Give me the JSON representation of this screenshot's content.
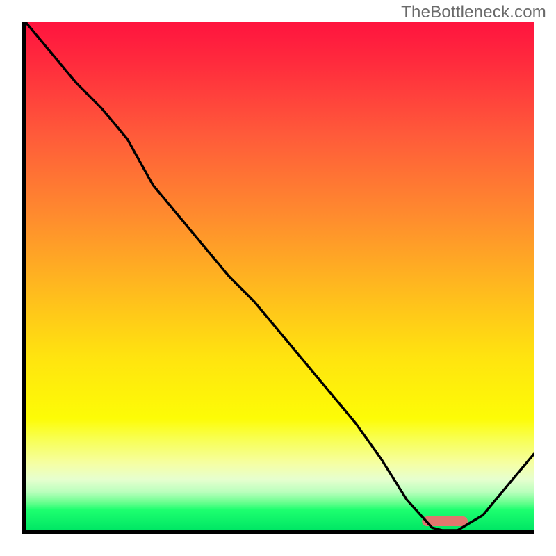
{
  "watermark": "TheBottleneck.com",
  "chart_data": {
    "type": "line",
    "title": "",
    "xlabel": "",
    "ylabel": "",
    "x": [
      0.0,
      0.05,
      0.1,
      0.15,
      0.2,
      0.25,
      0.3,
      0.35,
      0.4,
      0.45,
      0.5,
      0.55,
      0.6,
      0.65,
      0.7,
      0.75,
      0.8,
      0.82,
      0.85,
      0.9,
      0.95,
      1.0
    ],
    "values": [
      1.0,
      0.94,
      0.88,
      0.83,
      0.77,
      0.68,
      0.62,
      0.56,
      0.5,
      0.45,
      0.39,
      0.33,
      0.27,
      0.21,
      0.14,
      0.06,
      0.005,
      0.0,
      0.0,
      0.03,
      0.09,
      0.15
    ],
    "ylim": [
      0,
      1
    ],
    "xlim": [
      0,
      1
    ],
    "optimal_range": {
      "start": 0.78,
      "end": 0.87
    },
    "background_gradient": {
      "top": "#ff143e",
      "mid1": "#ff8b2e",
      "mid2": "#ffe40f",
      "bottom": "#00e664"
    }
  }
}
